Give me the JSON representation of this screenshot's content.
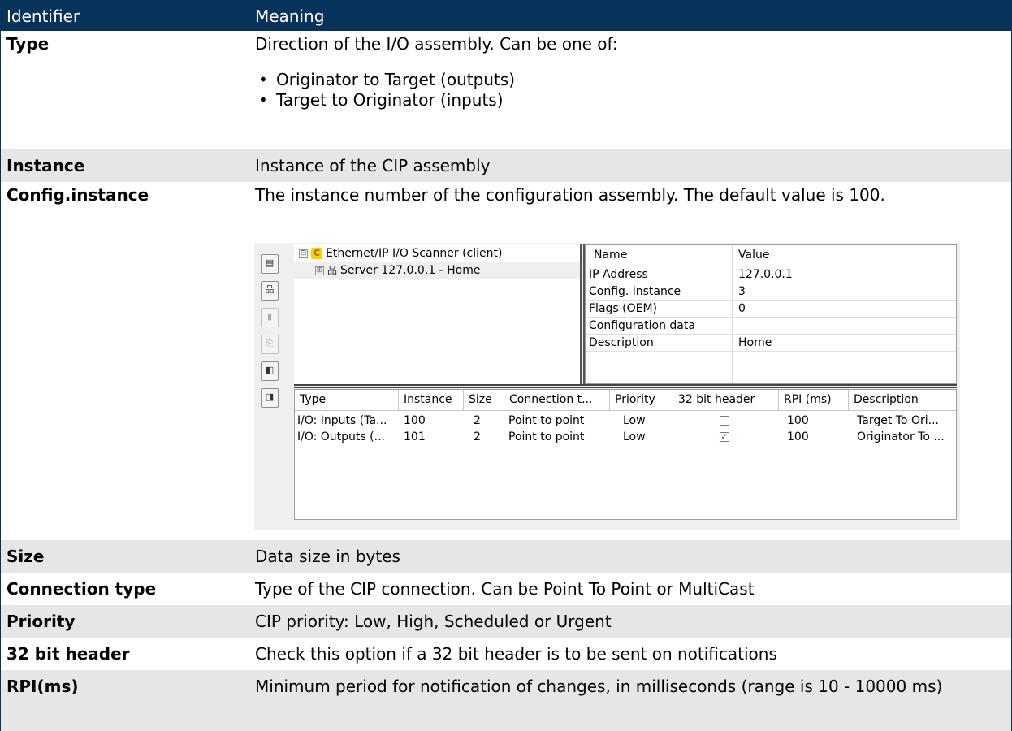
{
  "header": {
    "col1": "Identifier",
    "col2": "Meaning"
  },
  "rows": [
    {
      "term": "Type",
      "desc": "Direction of the I/O assembly. Can be one of:",
      "options": [
        "Originator to Target (outputs)",
        "Target to Originator (inputs)"
      ]
    },
    {
      "term": "Instance",
      "desc": "Instance of the CIP assembly"
    },
    {
      "term": "Config.instance",
      "desc": "The instance number of the configuration assembly. The default value is 100."
    },
    {
      "term": "Size",
      "desc": "Data size in bytes"
    },
    {
      "term": "Connection type",
      "desc": "Type of the CIP connection. Can be Point To Point or MultiCast"
    },
    {
      "term": "Priority",
      "desc": "CIP priority: Low, High, Scheduled or Urgent"
    },
    {
      "term": "32 bit header",
      "desc": "Check this option if a 32 bit header is to be sent on notifications"
    },
    {
      "term": "RPI(ms)",
      "desc": "Minimum period for notification of changes, in milliseconds (range is 10 - 10000 ms)"
    }
  ],
  "screenshot": {
    "toolbar_icons": [
      "tree-view-icon",
      "network-icon",
      "add-io-icon",
      "paste-icon",
      "import-icon",
      "export-icon"
    ],
    "tree": {
      "root": {
        "expander": "⊟",
        "icon_letter": "C",
        "label": "Ethernet/IP I/O Scanner (client)"
      },
      "child": {
        "expander": "⊞",
        "label": "Server 127.0.0.1 - Home"
      }
    },
    "properties": {
      "headers": [
        "Name",
        "Value"
      ],
      "rows": [
        [
          "IP Address",
          "127.0.0.1"
        ],
        [
          "Config. instance",
          "3"
        ],
        [
          "Flags (OEM)",
          "0"
        ],
        [
          "Configuration data",
          ""
        ],
        [
          "Description",
          "Home"
        ]
      ]
    },
    "connections": {
      "headers": [
        "Type",
        "Instance",
        "Size",
        "Connection t...",
        "Priority",
        "32 bit header",
        "RPI (ms)",
        "Description"
      ],
      "rows": [
        {
          "type": "I/O: Inputs (Ta...",
          "instance": "100",
          "size": "2",
          "connection": "Point to point",
          "priority": "Low",
          "header32": false,
          "rpi": "100",
          "description": "Target To Ori..."
        },
        {
          "type": "I/O: Outputs (...",
          "instance": "101",
          "size": "2",
          "connection": "Point to point",
          "priority": "Low",
          "header32": true,
          "rpi": "100",
          "description": "Originator To ..."
        }
      ]
    }
  }
}
